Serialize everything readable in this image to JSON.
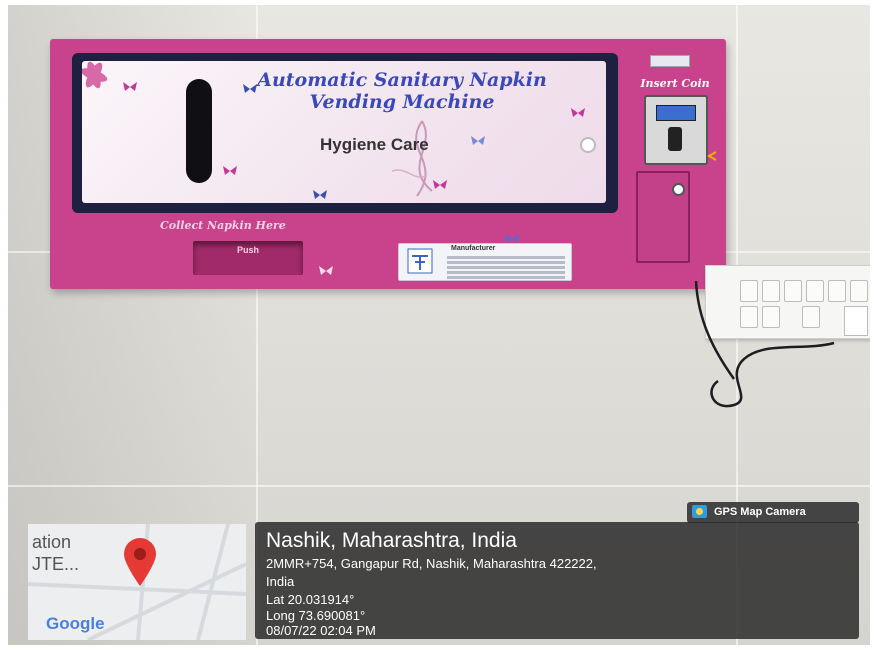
{
  "machine": {
    "title_line1": "Automatic Sanitary Napkin",
    "title_line2": "Vending Machine",
    "tagline": "Hygiene Care",
    "insert_coin_label": "Insert Coin",
    "collect_label": "Collect Napkin Here",
    "push_label": "Push",
    "manufacturer_label": "Manufacturer"
  },
  "gps_stamp": {
    "app_label": "GPS Map Camera",
    "location_title": "Nashik, Maharashtra, India",
    "address_line1": "2MMR+754, Gangapur Rd, Nashik, Maharashtra 422222,",
    "address_line2": "India",
    "latitude": "Lat 20.031914°",
    "longitude": "Long 73.690081°",
    "datetime": "08/07/22 02:04 PM"
  },
  "map_thumbnail": {
    "text_line1": "ation",
    "text_line2": "JTE...",
    "brand": "Google"
  },
  "colors": {
    "machine_pink": "#c8428c",
    "title_blue": "#3a48b8",
    "stamp_bg": "#2a2a2a",
    "pin_red": "#e53935"
  }
}
